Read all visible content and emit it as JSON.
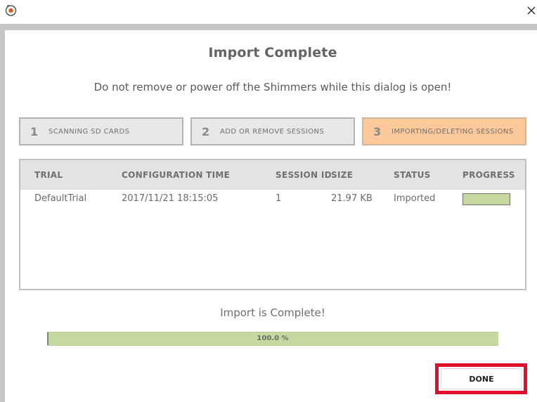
{
  "window": {
    "app_icon": "app-logo-icon",
    "close_icon": "close-icon"
  },
  "dialog": {
    "title": "Import Complete",
    "warning": "Do not remove or power off the Shimmers while this dialog is open!"
  },
  "steps": [
    {
      "number": "1",
      "label": "SCANNING SD CARDS",
      "active": false
    },
    {
      "number": "2",
      "label": "ADD OR REMOVE SESSIONS",
      "active": false
    },
    {
      "number": "3",
      "label": "IMPORTING/DELETING SESSIONS",
      "active": true
    }
  ],
  "table": {
    "columns": [
      "TRIAL",
      "CONFIGURATION TIME",
      "SESSION ID",
      "SIZE",
      "STATUS",
      "PROGRESS"
    ],
    "rows": [
      {
        "trial": "DefaultTrial",
        "configuration_time": "2017/11/21 18:15:05",
        "session_id": "1",
        "size": "21.97 KB",
        "status": "Imported",
        "progress": 1.0
      }
    ]
  },
  "import_message": "Import is Complete!",
  "overall_progress": {
    "label": "100.0 %",
    "value": 1.0
  },
  "done_button": {
    "label": "DONE"
  },
  "colors": {
    "active_step": "#fdc99a",
    "progress_fill": "#c6d9a0",
    "highlight_outline": "#e0102a"
  }
}
